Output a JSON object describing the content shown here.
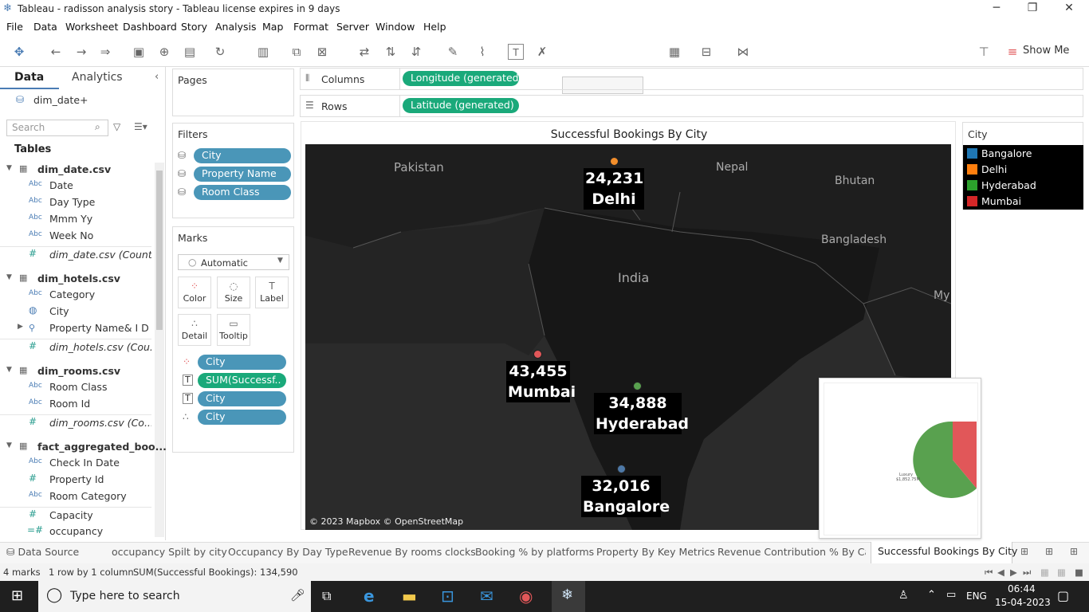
{
  "window": {
    "title": "Tableau - radisson analysis story - Tableau license expires in 9 days"
  },
  "menu": [
    "File",
    "Data",
    "Worksheet",
    "Dashboard",
    "Story",
    "Analysis",
    "Map",
    "Format",
    "Server",
    "Window",
    "Help"
  ],
  "toolbar": {
    "show_me": "Show Me"
  },
  "data_pane": {
    "tab_data": "Data",
    "tab_analytics": "Analytics",
    "datasource": "dim_date+",
    "search_placeholder": "Search",
    "tables_label": "Tables",
    "tables": [
      {
        "name": "dim_date.csv",
        "fields": [
          {
            "type": "Abc",
            "name": "Date"
          },
          {
            "type": "Abc",
            "name": "Day Type"
          },
          {
            "type": "Abc",
            "name": "Mmm Yy"
          },
          {
            "type": "Abc",
            "name": "Week No"
          },
          {
            "type": "#",
            "name": "dim_date.csv (Count)",
            "italic": true
          }
        ]
      },
      {
        "name": "dim_hotels.csv",
        "fields": [
          {
            "type": "Abc",
            "name": "Category"
          },
          {
            "type": "globe",
            "name": "City"
          },
          {
            "type": "hier",
            "name": "Property Name& I D"
          },
          {
            "type": "#",
            "name": "dim_hotels.csv (Cou...",
            "italic": true
          }
        ]
      },
      {
        "name": "dim_rooms.csv",
        "fields": [
          {
            "type": "Abc",
            "name": "Room Class"
          },
          {
            "type": "Abc",
            "name": "Room Id"
          },
          {
            "type": "#",
            "name": "dim_rooms.csv (Co...",
            "italic": true
          }
        ]
      },
      {
        "name": "fact_aggregated_boo...",
        "fields": [
          {
            "type": "Abc",
            "name": "Check In Date"
          },
          {
            "type": "#",
            "name": "Property Id"
          },
          {
            "type": "Abc",
            "name": "Room Category"
          },
          {
            "type": "#",
            "name": "Capacity"
          },
          {
            "type": "=#",
            "name": "occupancy"
          }
        ]
      }
    ]
  },
  "shelves": {
    "pages": "Pages",
    "filters_label": "Filters",
    "filters": [
      "City",
      "Property Name",
      "Room Class"
    ],
    "marks_label": "Marks",
    "mark_type": "Automatic",
    "mark_buttons": [
      "Color",
      "Size",
      "Label",
      "Detail",
      "Tooltip"
    ],
    "mark_pills": [
      {
        "icon": "color",
        "label": "City",
        "color": "blue"
      },
      {
        "icon": "label",
        "label": "SUM(Successf..",
        "color": "green"
      },
      {
        "icon": "label",
        "label": "City",
        "color": "blue"
      },
      {
        "icon": "detail",
        "label": "City",
        "color": "blue"
      }
    ],
    "columns_label": "Columns",
    "columns_pill": "Longitude (generated)",
    "rows_label": "Rows",
    "rows_pill": "Latitude (generated)"
  },
  "view": {
    "title": "Successful Bookings By City",
    "countries": [
      "Pakistan",
      "Nepal",
      "Bhutan",
      "India",
      "Bangladesh",
      "My"
    ],
    "attribution": "© 2023 Mapbox © OpenStreetMap",
    "points": [
      {
        "city": "Delhi",
        "value": "24,231",
        "color": "#f28e2b"
      },
      {
        "city": "Mumbai",
        "value": "43,455",
        "color": "#e15759"
      },
      {
        "city": "Hyderabad",
        "value": "34,888",
        "color": "#59a14f"
      },
      {
        "city": "Bangalore",
        "value": "32,016",
        "color": "#4e79a7"
      }
    ],
    "pie_tooltip": {
      "label": "Luxury",
      "value": "$1,852.75M"
    }
  },
  "legend": {
    "title": "City",
    "items": [
      {
        "name": "Bangalore",
        "color": "#1f77b4"
      },
      {
        "name": "Delhi",
        "color": "#ff7f0e"
      },
      {
        "name": "Hyderabad",
        "color": "#2ca02c"
      },
      {
        "name": "Mumbai",
        "color": "#d62728"
      }
    ]
  },
  "sheet_tabs": [
    "Data Source",
    "occupancy Spilt by city",
    "Occupancy By Day Type",
    "Revenue By rooms clocks",
    "Booking % by platforms",
    "Property By Key Metrics",
    "Revenue Contribution % By Cat...",
    "Successful Bookings By City"
  ],
  "status": {
    "marks": "4 marks",
    "dims": "1 row by 1 column",
    "sum": "SUM(Successful Bookings): 134,590"
  },
  "taskbar": {
    "search": "Type here to search",
    "lang": "ENG",
    "time": "06:44",
    "date": "15-04-2023"
  }
}
